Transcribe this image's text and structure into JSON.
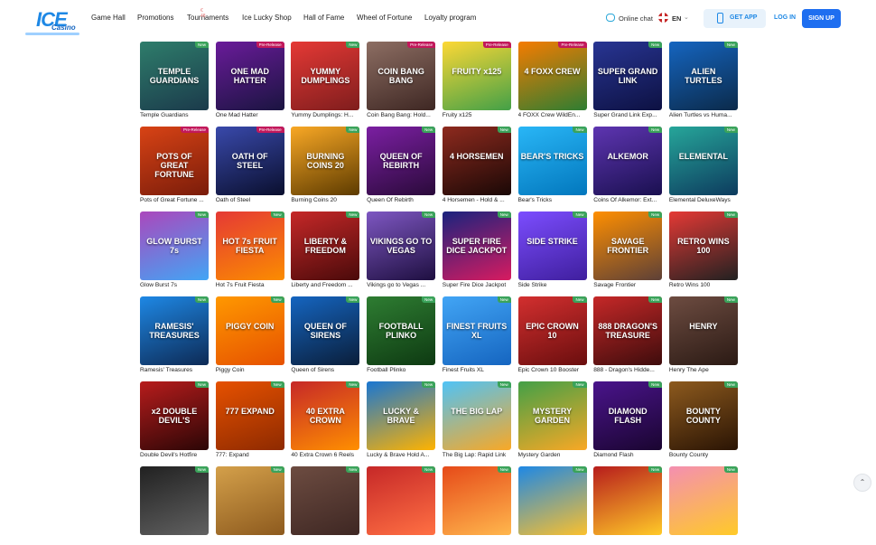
{
  "header": {
    "logo_text": "ICE",
    "logo_sub": "Casino",
    "nav": [
      {
        "label": "Game Hall"
      },
      {
        "label": "Promotions"
      },
      {
        "label": "Tournaments"
      },
      {
        "label": "Ice Lucky Shop"
      },
      {
        "label": "Hall of Fame"
      },
      {
        "label": "Wheel of Fortune"
      },
      {
        "label": "Loyalty program"
      }
    ],
    "tournaments_badge": "€ 48",
    "chat_label": "Online chat",
    "lang_label": "EN",
    "get_app_label": "GET APP",
    "login_label": "LOG IN",
    "signup_label": "SIGN UP"
  },
  "badges": {
    "new": "New",
    "pre": "Pre-Release"
  },
  "games": [
    {
      "name": "Temple Guardians",
      "art": "TEMPLE GUARDIANS",
      "badge": "new",
      "c1": "#2e7d6b",
      "c2": "#1b3a4b"
    },
    {
      "name": "One Mad Hatter",
      "art": "ONE MAD HATTER",
      "badge": "pre",
      "c1": "#6a1b9a",
      "c2": "#1a1440"
    },
    {
      "name": "Yummy Dumplings: H...",
      "art": "YUMMY DUMPLINGS",
      "badge": "new",
      "c1": "#e53935",
      "c2": "#7f1d1d"
    },
    {
      "name": "Coin Bang Bang: Hold...",
      "art": "COIN BANG BANG",
      "badge": "pre",
      "c1": "#8d6e63",
      "c2": "#3e2723"
    },
    {
      "name": "Fruity x125",
      "art": "FRUITY x125",
      "badge": "pre",
      "c1": "#fdd835",
      "c2": "#43a047"
    },
    {
      "name": "4 FOXX Crew WildEn...",
      "art": "4 FOXX CREW",
      "badge": "pre",
      "c1": "#f57c00",
      "c2": "#2e7d32"
    },
    {
      "name": "Super Grand Link Exp...",
      "art": "SUPER GRAND LINK",
      "badge": "new",
      "c1": "#283593",
      "c2": "#0d1142"
    },
    {
      "name": "Alien Turtles vs Huma...",
      "art": "ALIEN TURTLES",
      "badge": "new",
      "c1": "#1565c0",
      "c2": "#0b2a4a"
    },
    {
      "name": "Pots of Great Fortune ...",
      "art": "POTS OF GREAT FORTUNE",
      "badge": "pre",
      "c1": "#d84315",
      "c2": "#7a1c0a"
    },
    {
      "name": "Oath of Steel",
      "art": "OATH OF STEEL",
      "badge": "pre",
      "c1": "#3949ab",
      "c2": "#0a0f2e"
    },
    {
      "name": "Burning Coins 20",
      "art": "BURNING COINS 20",
      "badge": "new",
      "c1": "#f9a825",
      "c2": "#5d3b00"
    },
    {
      "name": "Queen Of Rebirth",
      "art": "QUEEN OF REBIRTH",
      "badge": "new",
      "c1": "#7b1fa2",
      "c2": "#2a0a3a"
    },
    {
      "name": "4 Horsemen - Hold & ...",
      "art": "4 HORSEMEN",
      "badge": "new",
      "c1": "#8e2a1e",
      "c2": "#1a0806"
    },
    {
      "name": "Bear's Tricks",
      "art": "BEAR'S TRICKS",
      "badge": "new",
      "c1": "#29b6f6",
      "c2": "#0277bd"
    },
    {
      "name": "Coins Of Alkemor: Ext...",
      "art": "ALKEMOR",
      "badge": "new",
      "c1": "#5e35b1",
      "c2": "#1a1050"
    },
    {
      "name": "Elemental DeluxeWays",
      "art": "ELEMENTAL",
      "badge": "new",
      "c1": "#26a69a",
      "c2": "#0d3b5e"
    },
    {
      "name": "Glow Burst 7s",
      "art": "GLOW BURST 7s",
      "badge": "new",
      "c1": "#ab47bc",
      "c2": "#42a5f5"
    },
    {
      "name": "Hot 7s Fruit Fiesta",
      "art": "HOT 7s FRUIT FIESTA",
      "badge": "new",
      "c1": "#e53935",
      "c2": "#fb8c00"
    },
    {
      "name": "Liberty and Freedom ...",
      "art": "LIBERTY & FREEDOM",
      "badge": "new",
      "c1": "#c62828",
      "c2": "#4a0a0a"
    },
    {
      "name": "Vikings go to Vegas ...",
      "art": "VIKINGS GO TO VEGAS",
      "badge": "new",
      "c1": "#7e57c2",
      "c2": "#1e0f40"
    },
    {
      "name": "Super Fire Dice Jackpot",
      "art": "SUPER FIRE DICE JACKPOT",
      "badge": "new",
      "c1": "#1a237e",
      "c2": "#d81b60"
    },
    {
      "name": "Side Strike",
      "art": "SIDE STRIKE",
      "badge": "new",
      "c1": "#7c4dff",
      "c2": "#3f1f9e"
    },
    {
      "name": "Savage Frontier",
      "art": "SAVAGE FRONTIER",
      "badge": "new",
      "c1": "#ff8f00",
      "c2": "#5d4037"
    },
    {
      "name": "Retro Wins 100",
      "art": "RETRO WINS 100",
      "badge": "new",
      "c1": "#e53935",
      "c2": "#212121"
    },
    {
      "name": "Ramesis' Treasures",
      "art": "RAMESIS' TREASURES",
      "badge": "new",
      "c1": "#1e88e5",
      "c2": "#0d2a55"
    },
    {
      "name": "Piggy Coin",
      "art": "PIGGY COIN",
      "badge": "new",
      "c1": "#ff9800",
      "c2": "#e65100"
    },
    {
      "name": "Queen of Sirens",
      "art": "QUEEN OF SIRENS",
      "badge": "new",
      "c1": "#1565c0",
      "c2": "#0a1e3a"
    },
    {
      "name": "Football Plinko",
      "art": "FOOTBALL PLINKO",
      "badge": "new",
      "c1": "#2e7d32",
      "c2": "#0e3a12"
    },
    {
      "name": "Finest Fruits XL",
      "art": "FINEST FRUITS XL",
      "badge": "new",
      "c1": "#42a5f5",
      "c2": "#1565c0"
    },
    {
      "name": "Epic Crown 10 Booster",
      "art": "EPIC CROWN 10",
      "badge": "new",
      "c1": "#d32f2f",
      "c2": "#6a0e0e"
    },
    {
      "name": "888 - Dragon's Hidde...",
      "art": "888 DRAGON'S TREASURE",
      "badge": "new",
      "c1": "#c62828",
      "c2": "#3e0c0c"
    },
    {
      "name": "Henry The Ape",
      "art": "HENRY",
      "badge": "new",
      "c1": "#6d4c41",
      "c2": "#2b1a14"
    },
    {
      "name": "Double Devil's Hotfire",
      "art": "x2 DOUBLE DEVIL'S",
      "badge": "new",
      "c1": "#b71c1c",
      "c2": "#2b0606"
    },
    {
      "name": "777: Expand",
      "art": "777 EXPAND",
      "badge": "new",
      "c1": "#e65100",
      "c2": "#8e2a00"
    },
    {
      "name": "40 Extra Crown 6 Reels",
      "art": "40 EXTRA CROWN",
      "badge": "new",
      "c1": "#c62828",
      "c2": "#ff8f00"
    },
    {
      "name": "Lucky & Brave Hold A...",
      "art": "LUCKY & BRAVE",
      "badge": "new",
      "c1": "#1976d2",
      "c2": "#ffb300"
    },
    {
      "name": "The Big Lap: Rapid Link",
      "art": "THE BIG LAP",
      "badge": "new",
      "c1": "#4fc3f7",
      "c2": "#f9a825"
    },
    {
      "name": "Mystery Garden",
      "art": "MYSTERY GARDEN",
      "badge": "new",
      "c1": "#43a047",
      "c2": "#f9a825"
    },
    {
      "name": "Diamond Flash",
      "art": "DIAMOND FLASH",
      "badge": "new",
      "c1": "#4a148c",
      "c2": "#1a0530"
    },
    {
      "name": "Bounty County",
      "art": "BOUNTY COUNTY",
      "badge": "new",
      "c1": "#8d5a1e",
      "c2": "#2a1404"
    },
    {
      "name": "",
      "art": "",
      "badge": "new",
      "c1": "#212121",
      "c2": "#616161"
    },
    {
      "name": "",
      "art": "",
      "badge": "new",
      "c1": "#d4a04a",
      "c2": "#8d5a1e"
    },
    {
      "name": "",
      "art": "",
      "badge": "new",
      "c1": "#6d4c41",
      "c2": "#3e2723"
    },
    {
      "name": "",
      "art": "",
      "badge": "new",
      "c1": "#c62828",
      "c2": "#ff7043"
    },
    {
      "name": "",
      "art": "",
      "badge": "new",
      "c1": "#e64a19",
      "c2": "#ffb74d"
    },
    {
      "name": "",
      "art": "",
      "badge": "new",
      "c1": "#1e88e5",
      "c2": "#fbc02d"
    },
    {
      "name": "",
      "art": "",
      "badge": "new",
      "c1": "#b71c1c",
      "c2": "#ffca28"
    },
    {
      "name": "",
      "art": "",
      "badge": "new",
      "c1": "#f48fb1",
      "c2": "#ffca28"
    }
  ]
}
